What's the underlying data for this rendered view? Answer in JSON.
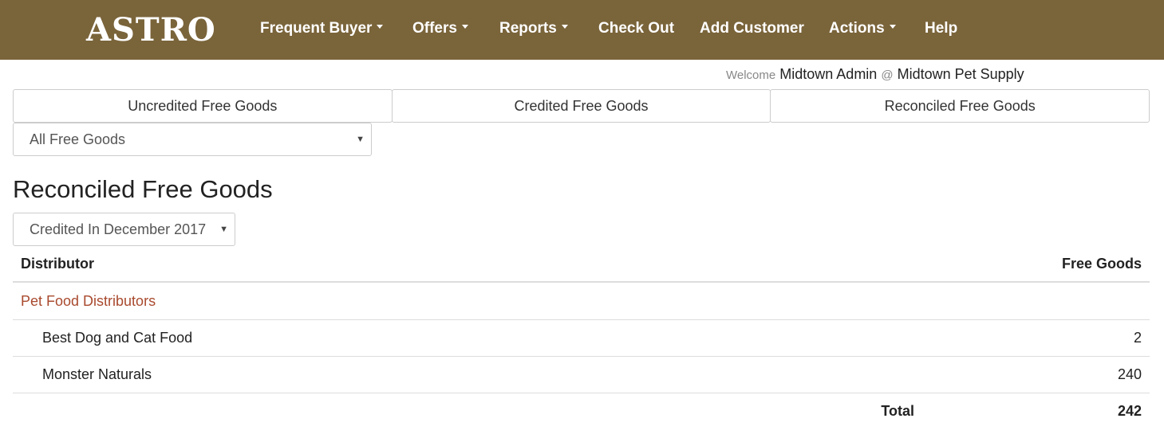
{
  "brand": {
    "logo": "ASTRO"
  },
  "nav": {
    "frequent_buyer": "Frequent Buyer",
    "offers": "Offers",
    "reports": "Reports",
    "check_out": "Check Out",
    "add_customer": "Add Customer",
    "actions": "Actions",
    "help": "Help"
  },
  "colors": {
    "navbar": "#7a643a",
    "group_link": "#a94a2e"
  },
  "welcome": {
    "prefix": "Welcome",
    "user": "Midtown Admin",
    "at": "@",
    "store": "Midtown Pet Supply"
  },
  "tabs": [
    "Uncredited Free Goods",
    "Credited Free Goods",
    "Reconciled Free Goods"
  ],
  "filter": {
    "selected": "All Free Goods"
  },
  "page": {
    "title": "Reconciled Free Goods"
  },
  "period": {
    "selected": "Credited In December 2017"
  },
  "table": {
    "headers": {
      "distributor": "Distributor",
      "free_goods": "Free Goods"
    },
    "group": "Pet Food Distributors",
    "rows": [
      {
        "name": "Best Dog and Cat Food",
        "free_goods": "2"
      },
      {
        "name": "Monster Naturals",
        "free_goods": "240"
      }
    ],
    "total": {
      "label": "Total",
      "value": "242"
    }
  }
}
